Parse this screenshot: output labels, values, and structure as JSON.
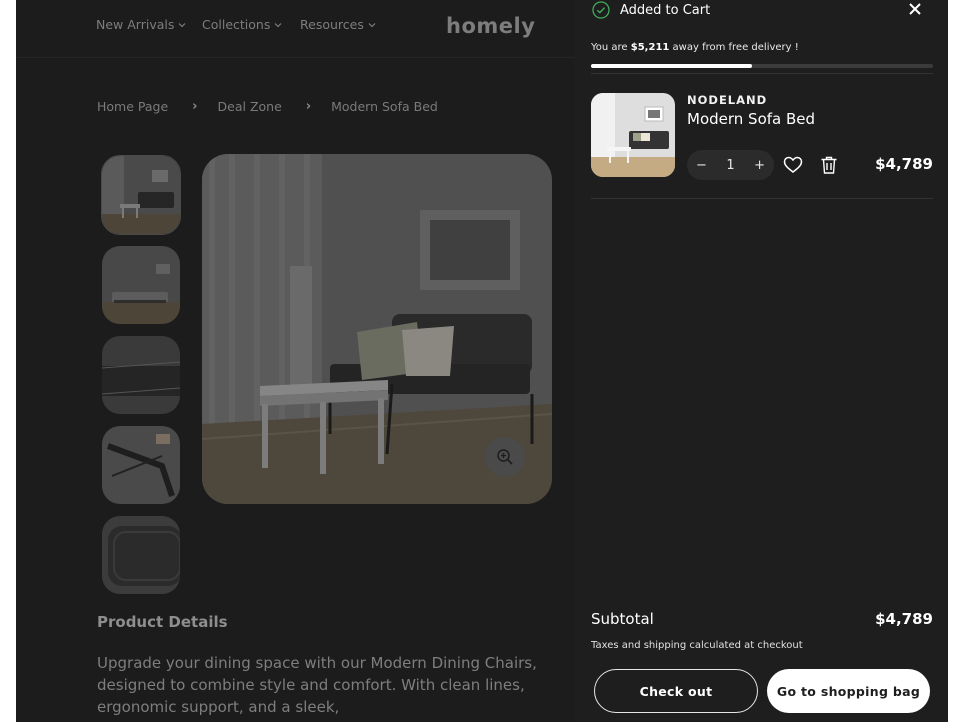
{
  "nav": {
    "items": [
      "New Arrivals",
      "Collections",
      "Resources"
    ],
    "logo": "homely"
  },
  "breadcrumb": [
    "Home Page",
    "Deal Zone",
    "Modern Sofa Bed"
  ],
  "product": {
    "details_title": "Product Details",
    "description": "Upgrade your dining space with our Modern Dining Chairs, designed to combine style and comfort. With clean lines, ergonomic support, and a sleek,"
  },
  "cart": {
    "added_label": "Added to Cart",
    "delivery_prefix": "You are ",
    "delivery_amount": "$5,211",
    "delivery_suffix": " away from free delivery !",
    "delivery_progress": 0.47,
    "item": {
      "brand": "NODELAND",
      "name": "Modern Sofa Bed",
      "qty_minus": "−",
      "quantity": "1",
      "qty_plus": "+",
      "price": "$4,789"
    },
    "subtotal_label": "Subtotal",
    "subtotal_value": "$4,789",
    "tax_note": "Taxes and shipping calculated at checkout",
    "checkout_label": "Check out",
    "bag_label": "Go to shopping bag"
  },
  "icons": [
    "chevron-down-icon",
    "chevron-right-icon",
    "zoom-in-icon",
    "check-circle-icon",
    "close-icon",
    "heart-icon",
    "trash-icon"
  ],
  "colors": {
    "drawer_bg": "#1e1e1e",
    "page_dim": "#1c1c1c",
    "accent_check": "#3fae5a"
  }
}
